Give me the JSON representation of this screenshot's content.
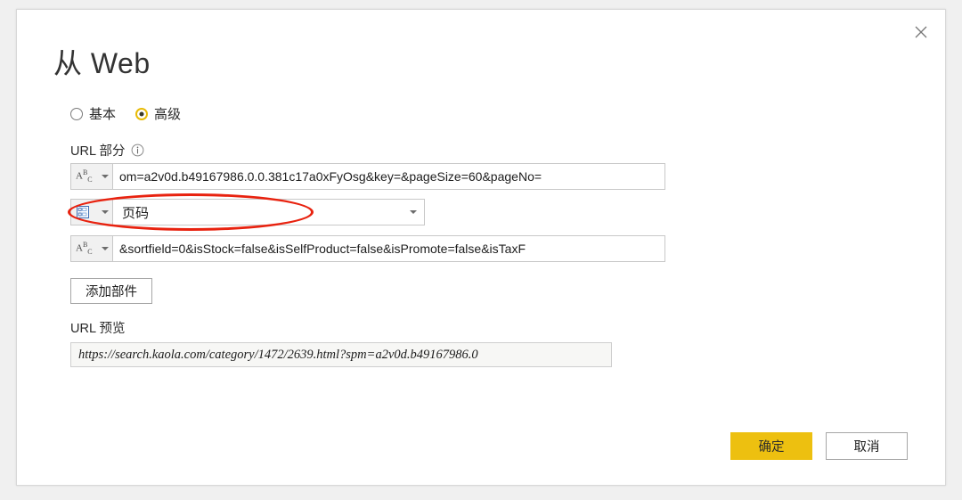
{
  "dialog": {
    "title": "从 Web",
    "close_label": "×",
    "mode_options": [
      {
        "label": "基本",
        "selected": false
      },
      {
        "label": "高级",
        "selected": true
      }
    ],
    "url_parts_label": "URL 部分",
    "info_icon": "info-circle-icon",
    "parts": [
      {
        "type_icon": "abc-text-type-icon",
        "type_glyph": "A",
        "type_glyph_sup": "B",
        "type_glyph_sub": "C",
        "value": "om=a2v0d.b49167986.0.0.381c17a0xFyOsg&key=&pageSize=60&pageNo=",
        "kind": "text"
      },
      {
        "type_icon": "parameter-list-type-icon",
        "value": "页码",
        "kind": "parameter"
      },
      {
        "type_icon": "abc-text-type-icon",
        "type_glyph": "A",
        "type_glyph_sup": "B",
        "type_glyph_sub": "C",
        "value": "&sortfield=0&isStock=false&isSelfProduct=false&isPromote=false&isTaxF",
        "kind": "text"
      }
    ],
    "add_part_label": "添加部件",
    "url_preview_label": "URL 预览",
    "url_preview_value": "https://search.kaola.com/category/1472/2639.html?spm=a2v0d.b49167986.0",
    "ok_label": "确定",
    "cancel_label": "取消"
  },
  "annotation": {
    "shape": "red-ellipse-highlight",
    "color": "#e8220f"
  },
  "colors": {
    "accent": "#edc010",
    "radio_selected": "#e8bb07",
    "annotation": "#e8220f",
    "dialog_bg": "#ffffff",
    "page_bg": "#f0f0f0"
  }
}
